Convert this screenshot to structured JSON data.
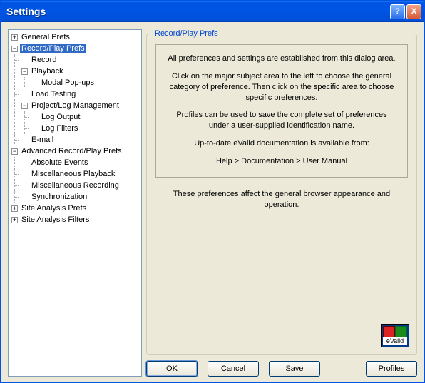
{
  "window": {
    "title": "Settings"
  },
  "titlebar_icons": {
    "help": "?",
    "close": "X"
  },
  "fieldset": {
    "legend": "Record/Play Prefs"
  },
  "info_box": {
    "p1": "All preferences and settings are established from this dialog area.",
    "p2": "Click on the major subject area to the left to choose the general category of preference.  Then click on the specific area to choose specific preferences.",
    "p3": "Profiles can be used to save the complete set of preferences under a user-supplied identification name.",
    "p4": "Up-to-date eValid documentation is available from:",
    "p5": "Help > Documentation > User Manual"
  },
  "outer_text": "These preferences affect the general browser appearance and operation.",
  "badge": {
    "label": "eValid"
  },
  "buttons": {
    "ok": "OK",
    "cancel": "Cancel",
    "save_pre": "S",
    "save_m": "a",
    "save_post": "ve",
    "profiles_pre": "",
    "profiles_m": "P",
    "profiles_post": "rofiles"
  },
  "tree": {
    "general_prefs": "General Prefs",
    "record_play_prefs": "Record/Play Prefs",
    "record": "Record",
    "playback": "Playback",
    "modal_popups": "Modal Pop-ups",
    "load_testing": "Load Testing",
    "project_log": "Project/Log Management",
    "log_output": "Log Output",
    "log_filters": "Log Filters",
    "email": "E-mail",
    "adv_record_play": "Advanced Record/Play Prefs",
    "absolute_events": "Absolute Events",
    "misc_playback": "Miscellaneous Playback",
    "misc_recording": "Miscellaneous Recording",
    "synchronization": "Synchronization",
    "site_analysis_prefs": "Site Analysis Prefs",
    "site_analysis_filters": "Site Analysis Filters"
  },
  "glyphs": {
    "plus": "+",
    "minus": "−"
  }
}
